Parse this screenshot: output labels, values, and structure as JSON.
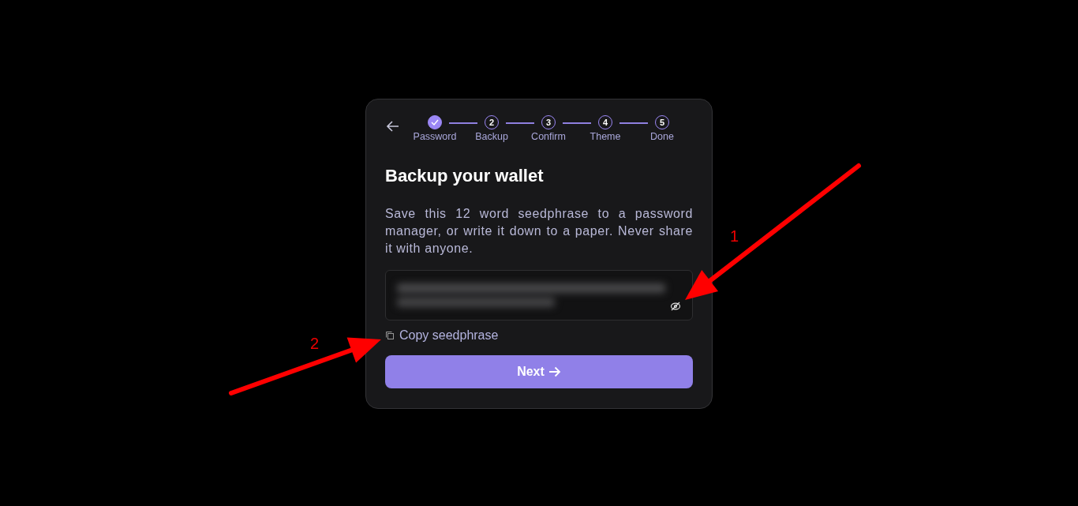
{
  "steps": [
    {
      "label": "Password",
      "completed": true
    },
    {
      "number": "2",
      "label": "Backup",
      "completed": false
    },
    {
      "number": "3",
      "label": "Confirm",
      "completed": false
    },
    {
      "number": "4",
      "label": "Theme",
      "completed": false
    },
    {
      "number": "5",
      "label": "Done",
      "completed": false
    }
  ],
  "title": "Backup your wallet",
  "description": "Save this 12 word seedphrase to a password manager, or write it down to a paper. Never share it with anyone.",
  "seedphrase": {
    "blurred": true
  },
  "copy_link": "Copy seedphrase",
  "next_button": "Next",
  "annotations": [
    {
      "label": "1"
    },
    {
      "label": "2"
    }
  ]
}
